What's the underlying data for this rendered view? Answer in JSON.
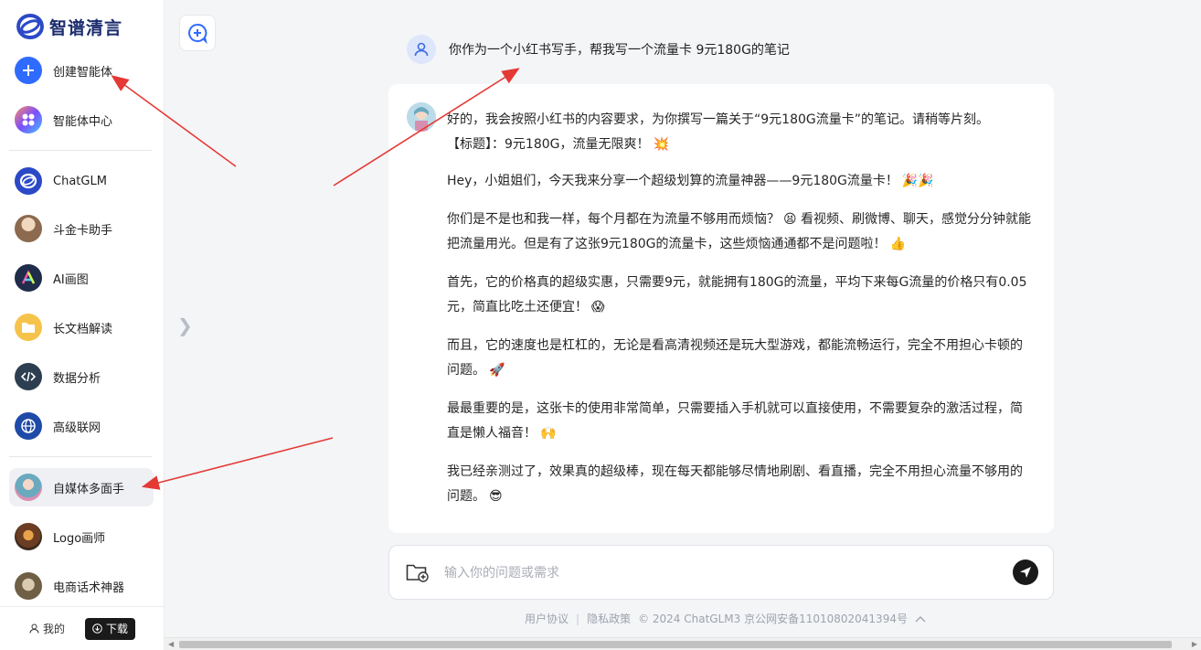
{
  "app": {
    "logo_text": "智谱清言"
  },
  "sidebar": {
    "items": [
      {
        "label": "创建智能体",
        "icon": "plus-icon",
        "color": "#2f6bff"
      },
      {
        "label": "智能体中心",
        "icon": "apps-icon",
        "color": "#ff7a59"
      },
      {
        "label": "ChatGLM",
        "icon": "chatglm-icon",
        "color": "#2b49c7"
      },
      {
        "label": "斗金卡助手",
        "icon": "avatar-icon",
        "color": "#b48a6a"
      },
      {
        "label": "AI画图",
        "icon": "ai-draw-icon",
        "color": "#1f2d4b"
      },
      {
        "label": "长文档解读",
        "icon": "folder-icon",
        "color": "#f6c34a"
      },
      {
        "label": "数据分析",
        "icon": "code-icon",
        "color": "#2c3e50"
      },
      {
        "label": "高级联网",
        "icon": "globe-icon",
        "color": "#1f4aa8"
      },
      {
        "label": "自媒体多面手",
        "icon": "avatar-icon",
        "color": "#7fb8c9"
      },
      {
        "label": "Logo画师",
        "icon": "avatar-icon",
        "color": "#8b5a3c"
      },
      {
        "label": "电商话术神器",
        "icon": "avatar-icon",
        "color": "#9b8a6e"
      }
    ],
    "footer": {
      "my_label": "我的",
      "download_label": "下载"
    }
  },
  "conversation": {
    "user_message": "你作为一个小红书写手，帮我写一个流量卡 9元180G的笔记",
    "bot_paragraphs": [
      {
        "text": "好的，我会按照小红书的内容要求，为你撰写一篇关于“9元180G流量卡”的笔记。请稍等片刻。",
        "emoji": ""
      },
      {
        "text": "【标题】：9元180G，流量无限爽！",
        "emoji": "💥"
      },
      {
        "text": "Hey，小姐姐们，今天我来分享一个超级划算的流量神器——9元180G流量卡！",
        "emoji": "🎉🎉"
      },
      {
        "text": "你们是不是也和我一样，每个月都在为流量不够用而烦恼？",
        "emoji": "😫",
        "text2": " 看视频、刷微博、聊天，感觉分分钟就能把流量用光。但是有了这张9元180G的流量卡，这些烦恼通通都不是问题啦！",
        "emoji2": "👍"
      },
      {
        "text": "首先，它的价格真的超级实惠，只需要9元，就能拥有180G的流量，平均下来每G流量的价格只有0.05元，简直比吃土还便宜！",
        "emoji": "😱"
      },
      {
        "text": "而且，它的速度也是杠杠的，无论是看高清视频还是玩大型游戏，都能流畅运行，完全不用担心卡顿的问题。",
        "emoji": "🚀"
      },
      {
        "text": "最最重要的是，这张卡的使用非常简单，只需要插入手机就可以直接使用，不需要复杂的激活过程，简直是懒人福音！",
        "emoji": "🙌"
      },
      {
        "text": "我已经亲测过了，效果真的超级棒，现在每天都能够尽情地刷剧、看直播，完全不用担心流量不够用的问题。",
        "emoji": "😎"
      }
    ]
  },
  "input": {
    "placeholder": "输入你的问题或需求"
  },
  "footer": {
    "terms": "用户协议",
    "privacy": "隐私政策",
    "copyright": "© 2024 ChatGLM3 京公网安备11010802041394号",
    "separator": "|"
  },
  "colors": {
    "accent": "#2f6bff",
    "annotation_arrow": "#e53935"
  }
}
